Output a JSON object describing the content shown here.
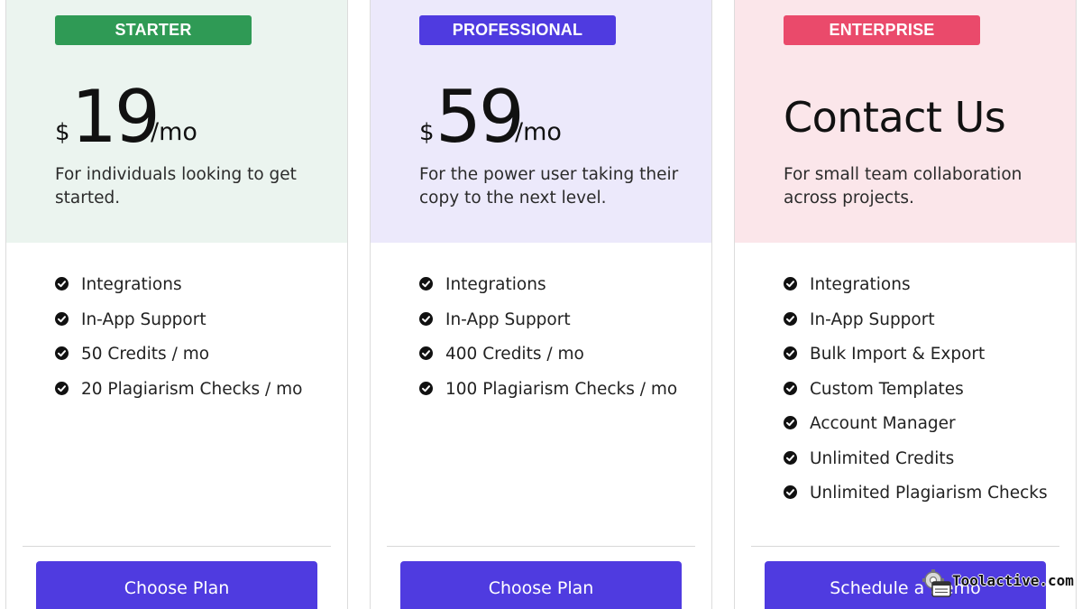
{
  "plans": [
    {
      "badge": "STARTER",
      "currency": "$",
      "amount": "19",
      "period": "/mo",
      "description": "For individuals looking to get started.",
      "features": [
        "Integrations",
        "In-App Support",
        "50 Credits / mo",
        "20 Plagiarism Checks / mo"
      ],
      "cta": "Choose Plan",
      "colors": {
        "badge": "#2f9a55",
        "header_bg": "#ebf4ef"
      }
    },
    {
      "badge": "PROFESSIONAL",
      "currency": "$",
      "amount": "59",
      "period": "/mo",
      "description": "For the power user taking their copy to the next level.",
      "features": [
        "Integrations",
        "In-App Support",
        "400 Credits / mo",
        "100 Plagiarism Checks / mo"
      ],
      "cta": "Choose Plan",
      "colors": {
        "badge": "#4f3be0",
        "header_bg": "#ece9fb"
      }
    },
    {
      "badge": "ENTERPRISE",
      "headline": "Contact Us",
      "description": "For small team collaboration across projects.",
      "features": [
        "Integrations",
        "In-App Support",
        "Bulk Import & Export",
        "Custom Templates",
        "Account Manager",
        "Unlimited Credits",
        "Unlimited Plagiarism Checks"
      ],
      "cta": "Schedule a Demo",
      "colors": {
        "badge": "#ea4a6b",
        "header_bg": "#fbe6ea"
      }
    }
  ],
  "icons": {
    "feature_bullet": "check-circle-icon",
    "watermark_logo": "gear-window-icon"
  },
  "button_color": "#4f3be0",
  "watermark": {
    "text": "Toolactive.com"
  }
}
